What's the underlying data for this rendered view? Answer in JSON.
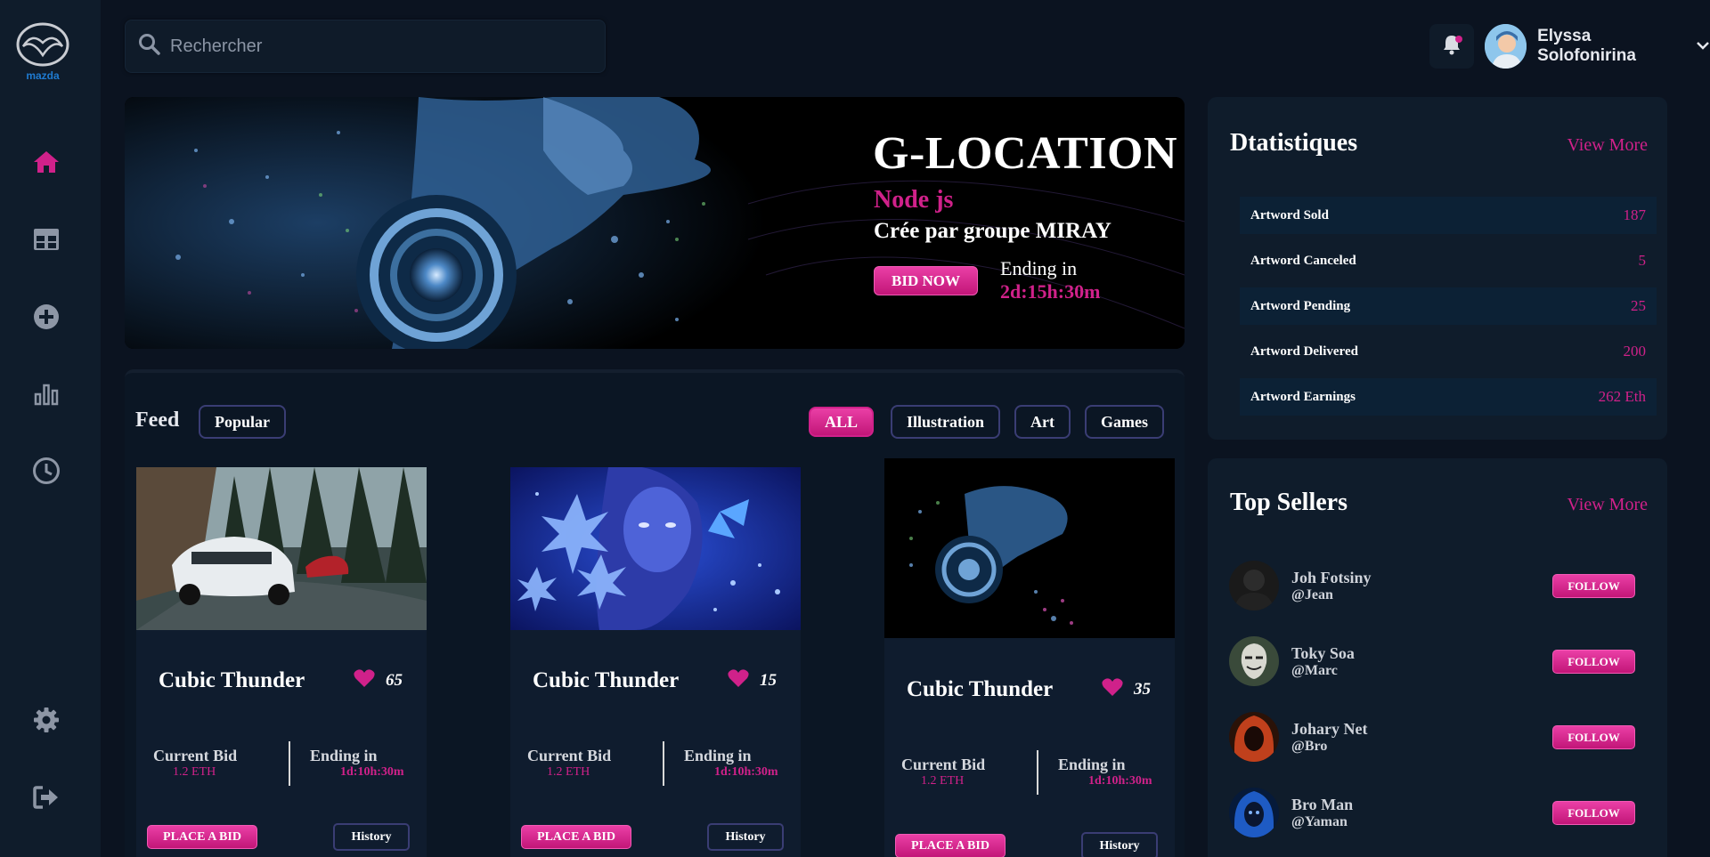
{
  "brand": {
    "logo_text": "mazda",
    "accent": "#d0218a"
  },
  "sidebar": {
    "items": [
      {
        "icon": "home-icon",
        "active": true
      },
      {
        "icon": "table-icon"
      },
      {
        "icon": "add-circle-icon"
      },
      {
        "icon": "bar-chart-icon"
      },
      {
        "icon": "clock-icon"
      },
      {
        "icon": "gear-icon"
      },
      {
        "icon": "logout-icon"
      }
    ]
  },
  "search": {
    "placeholder": "Rechercher"
  },
  "user": {
    "name": "Elyssa Solofonirina"
  },
  "hero": {
    "title": "G-LOCATION",
    "subtitle": "Node js",
    "author": "Crée par groupe MIRAY",
    "bid_label": "BID NOW",
    "ending_label": "Ending in",
    "ending_time": "2d:15h:30m"
  },
  "feed": {
    "title": "Feed",
    "popular_label": "Popular",
    "filters": [
      "ALL",
      "Illustration",
      "Art",
      "Games"
    ],
    "active_filter": "ALL",
    "cards": [
      {
        "title": "Cubic Thunder",
        "likes": "65",
        "current_bid_label": "Current Bid",
        "current_bid": "1.2 ETH",
        "ending_label": "Ending in",
        "ending": "1d:10h:30m",
        "bid_button": "PLACE A BID",
        "history_button": "History"
      },
      {
        "title": "Cubic Thunder",
        "likes": "15",
        "current_bid_label": "Current Bid",
        "current_bid": "1.2 ETH",
        "ending_label": "Ending in",
        "ending": "1d:10h:30m",
        "bid_button": "PLACE A BID",
        "history_button": "History"
      },
      {
        "title": "Cubic Thunder",
        "likes": "35",
        "current_bid_label": "Current Bid",
        "current_bid": "1.2 ETH",
        "ending_label": "Ending in",
        "ending": "1d:10h:30m",
        "bid_button": "PLACE A BID",
        "history_button": "History"
      }
    ]
  },
  "stats": {
    "title": "Dtatistiques",
    "view_more": "View More",
    "rows": [
      {
        "label": "Artword Sold",
        "value": "187"
      },
      {
        "label": "Artword Canceled",
        "value": "5"
      },
      {
        "label": "Artword Pending",
        "value": "25"
      },
      {
        "label": "Artword Delivered",
        "value": "200"
      },
      {
        "label": "Artword Earnings",
        "value": "262 Eth"
      }
    ]
  },
  "top_sellers": {
    "title": "Top Sellers",
    "view_more": "View More",
    "follow_label": "FOLLOW",
    "sellers": [
      {
        "name": "Joh Fotsiny",
        "handle": "@Jean"
      },
      {
        "name": "Toky Soa",
        "handle": "@Marc"
      },
      {
        "name": "Johary Net",
        "handle": "@Bro"
      },
      {
        "name": "Bro Man",
        "handle": "@Yaman"
      }
    ]
  }
}
